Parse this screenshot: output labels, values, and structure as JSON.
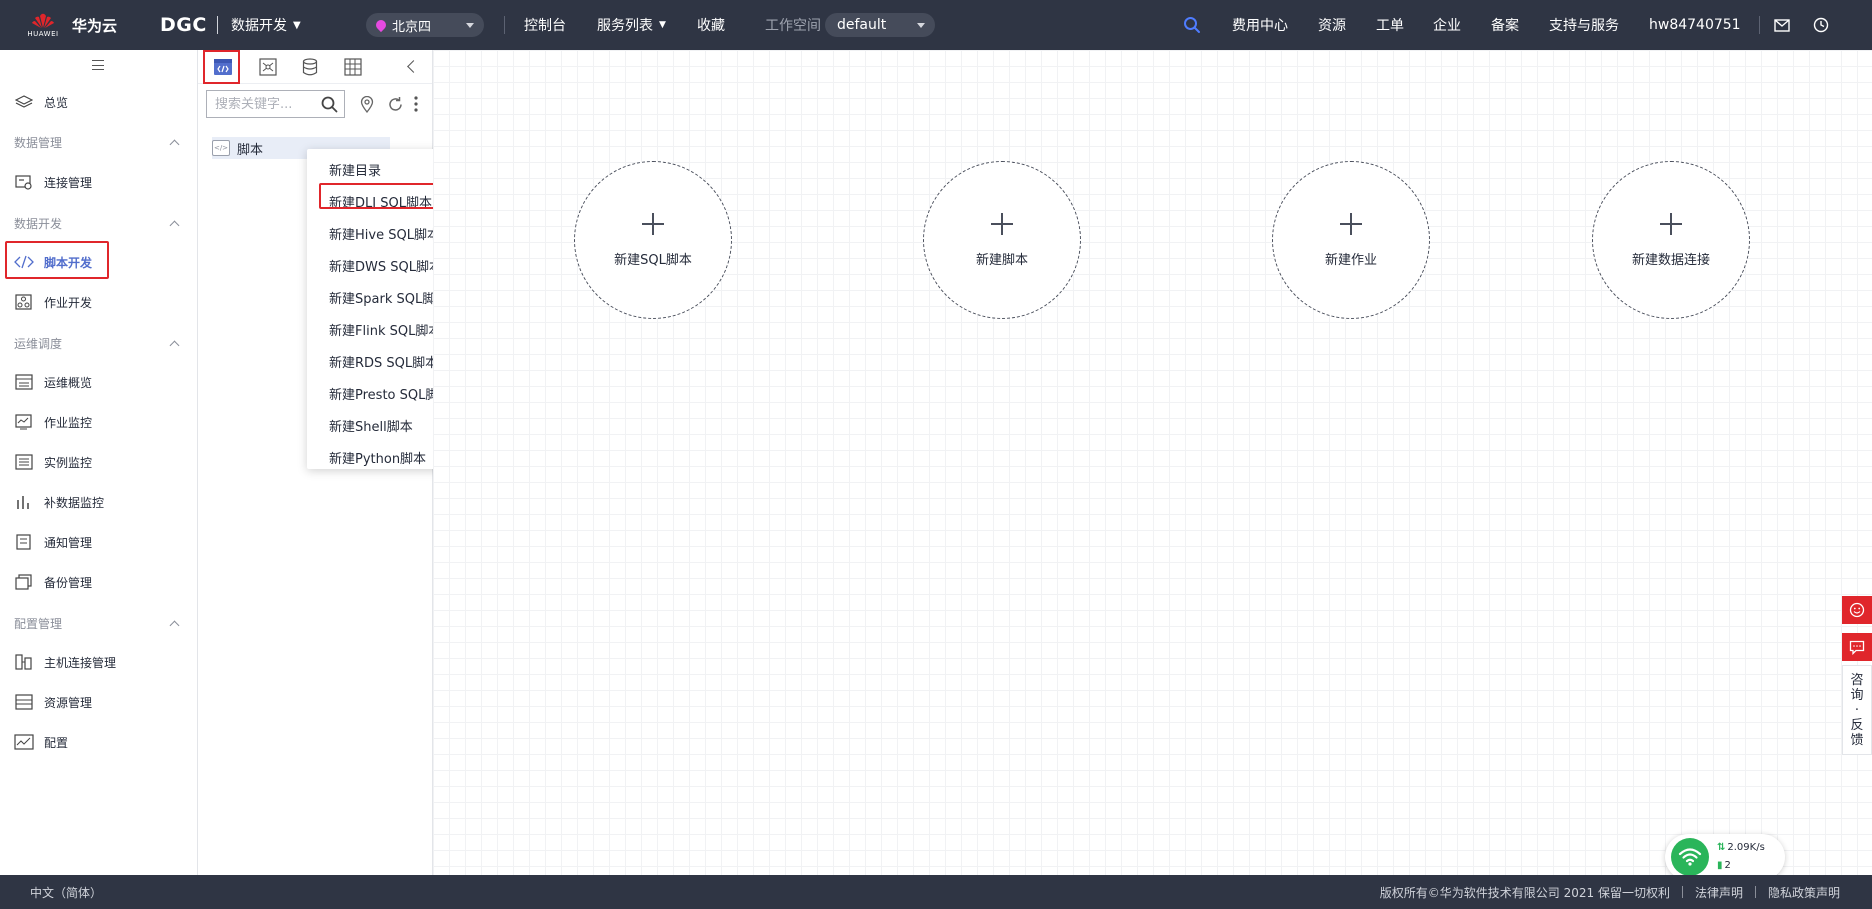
{
  "header": {
    "brand_en": "HUAWEI",
    "brand": "华为云",
    "product": "DGC",
    "module": "数据开发",
    "region": "北京四",
    "nav": [
      "控制台",
      "服务列表",
      "收藏"
    ],
    "workspace_label": "工作空间",
    "workspace_value": "default",
    "right_nav": [
      "费用中心",
      "资源",
      "工单",
      "企业",
      "备案",
      "支持与服务"
    ],
    "username": "hw84740751"
  },
  "sidebar": {
    "overview": "总览",
    "groups": [
      {
        "title": "数据管理",
        "items": [
          "连接管理"
        ]
      },
      {
        "title": "数据开发",
        "items": [
          "脚本开发",
          "作业开发"
        ]
      },
      {
        "title": "运维调度",
        "items": [
          "运维概览",
          "作业监控",
          "实例监控",
          "补数据监控",
          "通知管理",
          "备份管理"
        ]
      },
      {
        "title": "配置管理",
        "items": [
          "主机连接管理",
          "资源管理",
          "配置"
        ]
      }
    ],
    "active_item": "脚本开发"
  },
  "tree": {
    "search_placeholder": "搜索关键字...",
    "root_node": "脚本"
  },
  "context_menu": {
    "items": [
      "新建目录",
      "新建DLI SQL脚本",
      "新建Hive SQL脚本",
      "新建DWS SQL脚本",
      "新建Spark SQL脚本",
      "新建Flink SQL脚本",
      "新建RDS SQL脚本",
      "新建Presto SQL脚本",
      "新建Shell脚本",
      "新建Python脚本"
    ],
    "highlighted": "新建DLI SQL脚本"
  },
  "main": {
    "quick_actions": [
      "新建SQL脚本",
      "新建脚本",
      "新建作业",
      "新建数据连接"
    ]
  },
  "float": {
    "feedback_chars": [
      "咨",
      "询",
      "·",
      "反",
      "馈"
    ]
  },
  "network": {
    "speed": "2.09K/s",
    "count": "2"
  },
  "footer": {
    "language": "中文（简体）",
    "copyright": "版权所有©华为软件技术有限公司 2021 保留一切权利",
    "legal": "法律声明",
    "privacy": "隐私政策声明"
  },
  "colors": {
    "topbar": "#2f3544",
    "accent": "#526ecc",
    "highlight_box": "#e0262b",
    "region_pin": "#e64ae0",
    "network_ok": "#2ab55a"
  },
  "icons": {
    "search": "search-icon",
    "mail": "mail-icon",
    "clock": "clock-icon",
    "location": "location-icon",
    "refresh": "refresh-icon",
    "more": "more-icon"
  }
}
